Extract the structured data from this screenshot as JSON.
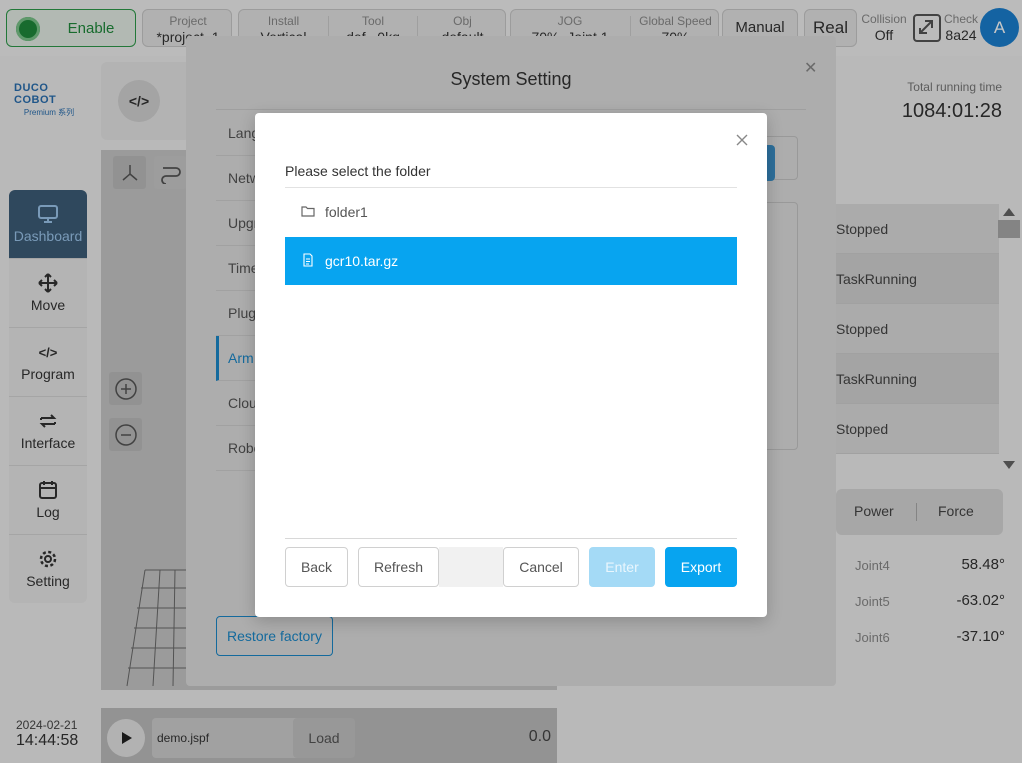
{
  "topbar": {
    "enable_label": "Enable",
    "project": {
      "label": "Project",
      "value": "*project_1"
    },
    "install": {
      "label": "Install",
      "value": "Vertical"
    },
    "tool": {
      "label": "Tool",
      "value": "def",
      "value2": "0kg"
    },
    "obj": {
      "label": "Obj",
      "value": "default"
    },
    "jog": {
      "label": "JOG",
      "value": "70%",
      "value2": "Joint 1"
    },
    "global_speed": {
      "label": "Global Speed",
      "value": "70%"
    },
    "mode_label": "Manual",
    "real_label": "Real",
    "collision": {
      "label": "Collision",
      "value": "Off"
    },
    "check": {
      "label": "Check",
      "value": "8a24"
    },
    "avatar_letter": "A"
  },
  "logo": {
    "line1": "DUCO COBOT",
    "line2": "Premium 系列"
  },
  "sidebar": {
    "items": [
      {
        "label": "Dashboard",
        "icon": "monitor-icon",
        "active": true
      },
      {
        "label": "Move",
        "icon": "move-arrows-icon",
        "active": false
      },
      {
        "label": "Program",
        "icon": "code-icon",
        "active": false
      },
      {
        "label": "Interface",
        "icon": "swap-icon",
        "active": false
      },
      {
        "label": "Log",
        "icon": "calendar-icon",
        "active": false
      },
      {
        "label": "Setting",
        "icon": "gear-icon",
        "active": false
      }
    ]
  },
  "datetime": {
    "date": "2024-02-21",
    "time": "14:44:58"
  },
  "runtime": {
    "label": "Total running time",
    "value": "1084:01:28"
  },
  "tasks": [
    "Stopped",
    "TaskRunning",
    "Stopped",
    "TaskRunning",
    "Stopped"
  ],
  "power_tabs": {
    "power": "Power",
    "force": "Force"
  },
  "joints": [
    {
      "name": "Joint4",
      "value": "58.48°"
    },
    {
      "name": "Joint5",
      "value": "-63.02°"
    },
    {
      "name": "Joint6",
      "value": "-37.10°"
    }
  ],
  "bottom": {
    "file": "demo.jspf",
    "load_label": "Load",
    "speed_value": "0.0"
  },
  "system_setting": {
    "title": "System Setting",
    "menu": [
      "Lang",
      "Netw",
      "Upgr",
      "Time",
      "Plug",
      "Arm",
      "Clou",
      "Robo"
    ],
    "active_index": 5,
    "restore_label": "Restore factory"
  },
  "file_dialog": {
    "title": "Please select the folder",
    "items": [
      {
        "name": "folder1",
        "type": "folder",
        "selected": false
      },
      {
        "name": "gcr10.tar.gz",
        "type": "file",
        "selected": true
      }
    ],
    "buttons": {
      "back": "Back",
      "refresh": "Refresh",
      "cancel": "Cancel",
      "enter": "Enter",
      "export": "Export"
    }
  },
  "colors": {
    "accent": "#07a4f0",
    "enable_green": "#1f8a3b",
    "sidebar_active": "#3d5d78"
  }
}
